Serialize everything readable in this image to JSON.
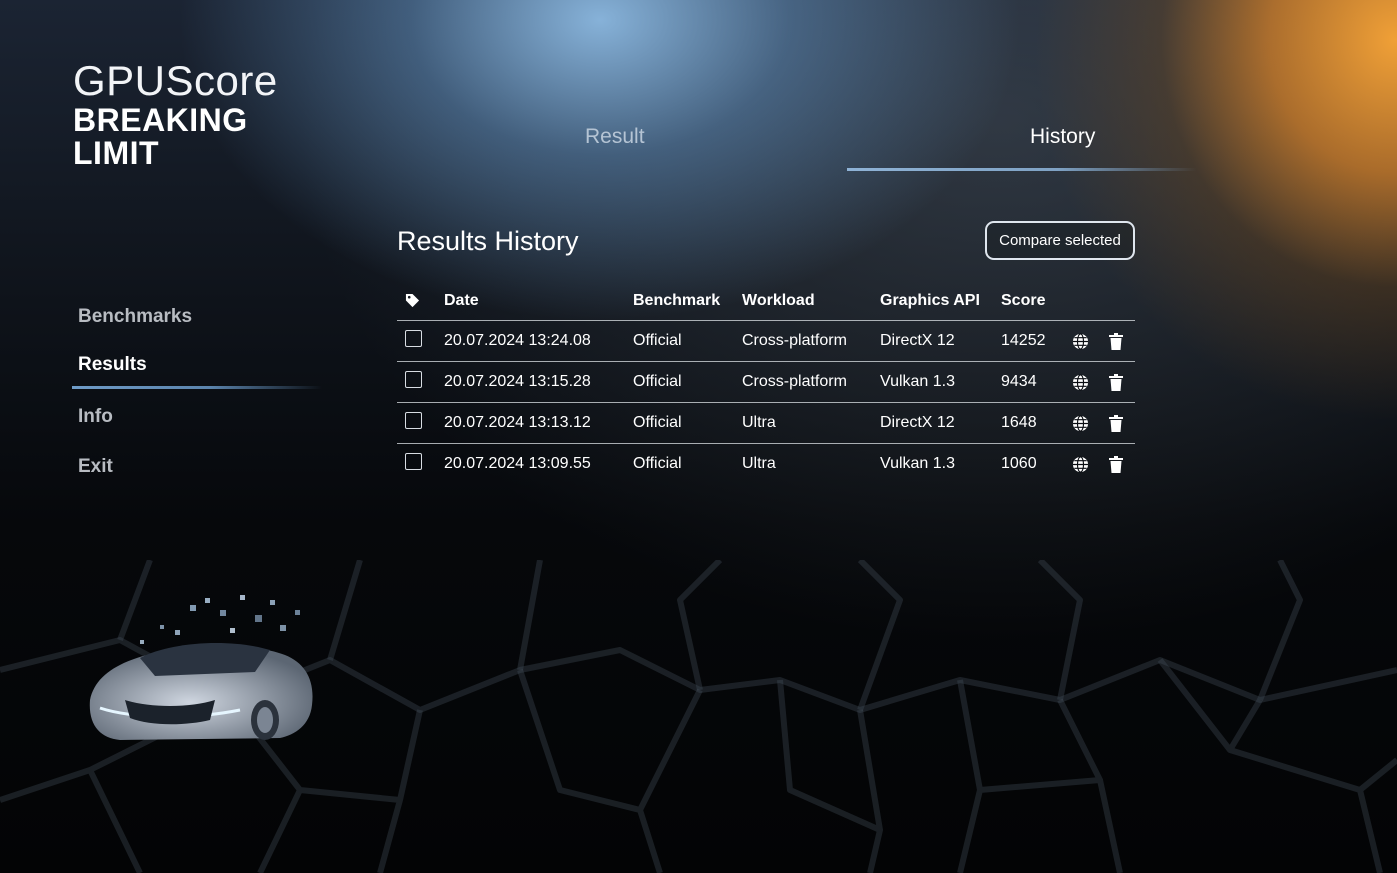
{
  "logo": {
    "title": "GPUScore",
    "subtitle_line1": "BREAKING",
    "subtitle_line2": "LIMIT"
  },
  "sidebar": {
    "items": [
      {
        "label": "Benchmarks",
        "active": false
      },
      {
        "label": "Results",
        "active": true
      },
      {
        "label": "Info",
        "active": false
      },
      {
        "label": "Exit",
        "active": false
      }
    ]
  },
  "tabs": [
    {
      "label": "Result",
      "active": false
    },
    {
      "label": "History",
      "active": true
    }
  ],
  "main": {
    "title": "Results History",
    "compare_label": "Compare selected",
    "columns": {
      "tag_icon": "tag-icon",
      "date": "Date",
      "benchmark": "Benchmark",
      "workload": "Workload",
      "api": "Graphics API",
      "score": "Score"
    },
    "rows": [
      {
        "checked": false,
        "date": "20.07.2024 13:24.08",
        "benchmark": "Official",
        "workload": "Cross-platform",
        "api": "DirectX 12",
        "score": "14252"
      },
      {
        "checked": false,
        "date": "20.07.2024 13:15.28",
        "benchmark": "Official",
        "workload": "Cross-platform",
        "api": "Vulkan 1.3",
        "score": "9434"
      },
      {
        "checked": false,
        "date": "20.07.2024 13:13.12",
        "benchmark": "Official",
        "workload": "Ultra",
        "api": "DirectX 12",
        "score": "1648"
      },
      {
        "checked": false,
        "date": "20.07.2024 13:09.55",
        "benchmark": "Official",
        "workload": "Ultra",
        "api": "Vulkan 1.3",
        "score": "1060"
      }
    ],
    "row_icons": [
      "globe-icon",
      "trash-icon"
    ]
  },
  "colors": {
    "accent_blue": "#6f9cc8",
    "accent_orange": "#f0a037",
    "background": "#05070b"
  }
}
